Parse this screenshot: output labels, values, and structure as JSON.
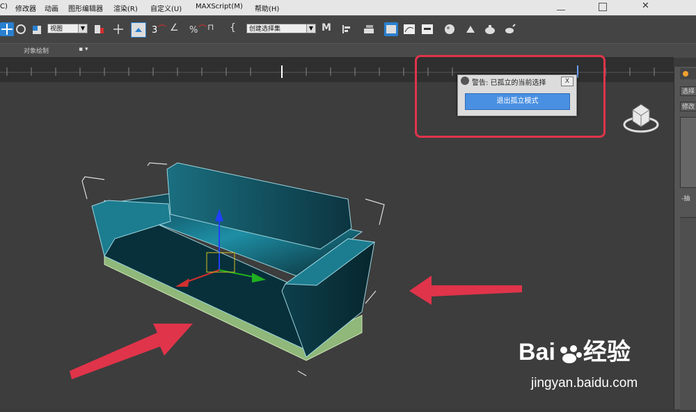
{
  "menu": {
    "items": [
      "C)",
      "修改器",
      "动画",
      "图形编辑器",
      "渲染(R)",
      "自定义(U)",
      "MAXScript(M)",
      "帮助(H)"
    ]
  },
  "toolbar": {
    "view_combo": "视图",
    "named_selection_combo": "创建选择集",
    "snap_label": "3",
    "percent_label": "%"
  },
  "ribbon": {
    "label": "对象绘制",
    "dropdown": "▪ ▾"
  },
  "right_panel": {
    "tab1": "选择",
    "tab2": "修改",
    "small_label": "-抽"
  },
  "dialog": {
    "title": "警告: 已孤立的当前选择",
    "close": "X",
    "button": "退出孤立模式"
  },
  "watermark": {
    "brand_left": "Bai",
    "brand_right": "经验",
    "url": "jingyan.baidu.com"
  },
  "colors": {
    "highlight": "#e0344a",
    "accent": "#4a90e2",
    "sofa": "#1b7a8c"
  }
}
